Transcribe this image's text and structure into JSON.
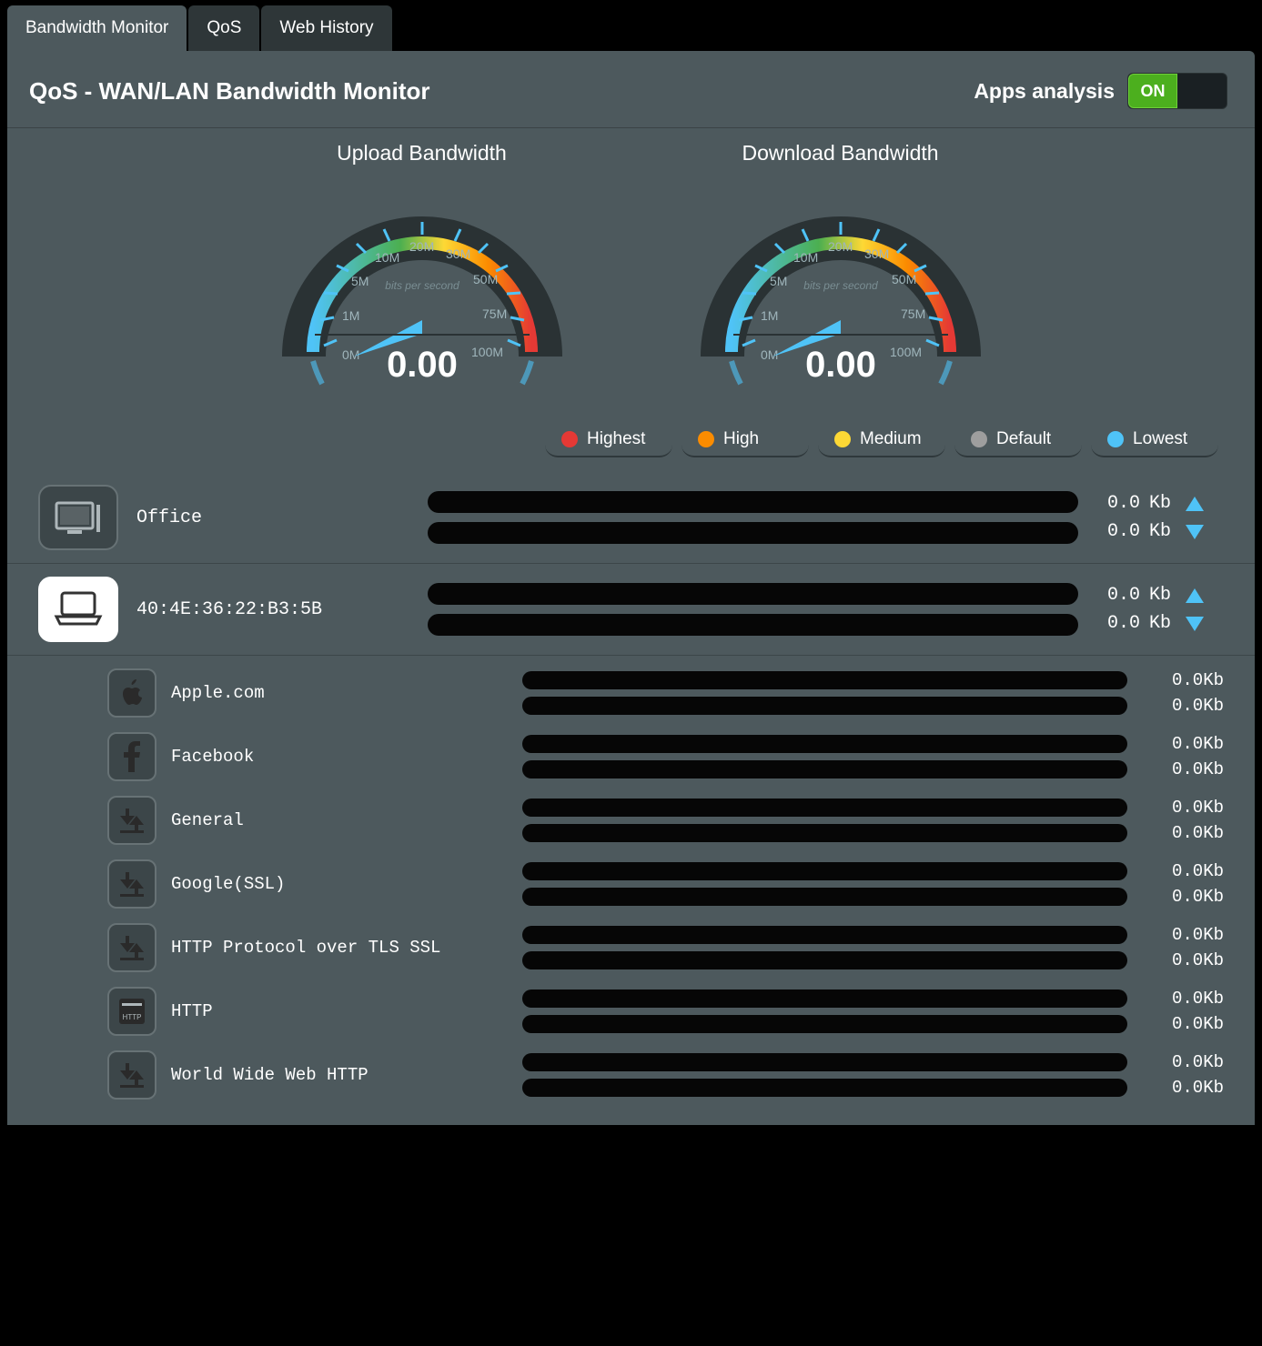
{
  "tabs": [
    {
      "label": "Bandwidth Monitor",
      "active": true
    },
    {
      "label": "QoS",
      "active": false
    },
    {
      "label": "Web History",
      "active": false
    }
  ],
  "header": {
    "title": "QoS - WAN/LAN Bandwidth Monitor",
    "toggle_label": "Apps analysis",
    "toggle_state": "ON"
  },
  "gauges": {
    "upload": {
      "title": "Upload Bandwidth",
      "value": "0.00",
      "unit_label": "bits per second",
      "ticks": [
        "0M",
        "1M",
        "5M",
        "10M",
        "20M",
        "30M",
        "50M",
        "75M",
        "100M"
      ]
    },
    "download": {
      "title": "Download Bandwidth",
      "value": "0.00",
      "unit_label": "bits per second",
      "ticks": [
        "0M",
        "1M",
        "5M",
        "10M",
        "20M",
        "30M",
        "50M",
        "75M",
        "100M"
      ]
    }
  },
  "legend": [
    {
      "label": "Highest",
      "color": "#E53935"
    },
    {
      "label": "High",
      "color": "#FB8C00"
    },
    {
      "label": "Medium",
      "color": "#FDD835"
    },
    {
      "label": "Default",
      "color": "#9E9E9E"
    },
    {
      "label": "Lowest",
      "color": "#4FC3F7"
    }
  ],
  "devices": [
    {
      "name": "Office",
      "icon": "desktop",
      "icon_style": "dark",
      "up": {
        "value": "0.0",
        "unit": "Kb"
      },
      "down": {
        "value": "0.0",
        "unit": "Kb"
      },
      "apps": []
    },
    {
      "name": "40:4E:36:22:B3:5B",
      "icon": "laptop",
      "icon_style": "light",
      "up": {
        "value": "0.0",
        "unit": "Kb"
      },
      "down": {
        "value": "0.0",
        "unit": "Kb"
      },
      "apps": [
        {
          "name": "Apple.com",
          "icon": "apple",
          "up": "0.0Kb",
          "down": "0.0Kb"
        },
        {
          "name": "Facebook",
          "icon": "facebook",
          "up": "0.0Kb",
          "down": "0.0Kb"
        },
        {
          "name": "General",
          "icon": "transfer",
          "up": "0.0Kb",
          "down": "0.0Kb"
        },
        {
          "name": "Google(SSL)",
          "icon": "transfer",
          "up": "0.0Kb",
          "down": "0.0Kb"
        },
        {
          "name": "HTTP Protocol over TLS SSL",
          "icon": "transfer",
          "up": "0.0Kb",
          "down": "0.0Kb"
        },
        {
          "name": "HTTP",
          "icon": "http",
          "up": "0.0Kb",
          "down": "0.0Kb"
        },
        {
          "name": "World Wide Web HTTP",
          "icon": "transfer",
          "up": "0.0Kb",
          "down": "0.0Kb"
        }
      ]
    }
  ]
}
